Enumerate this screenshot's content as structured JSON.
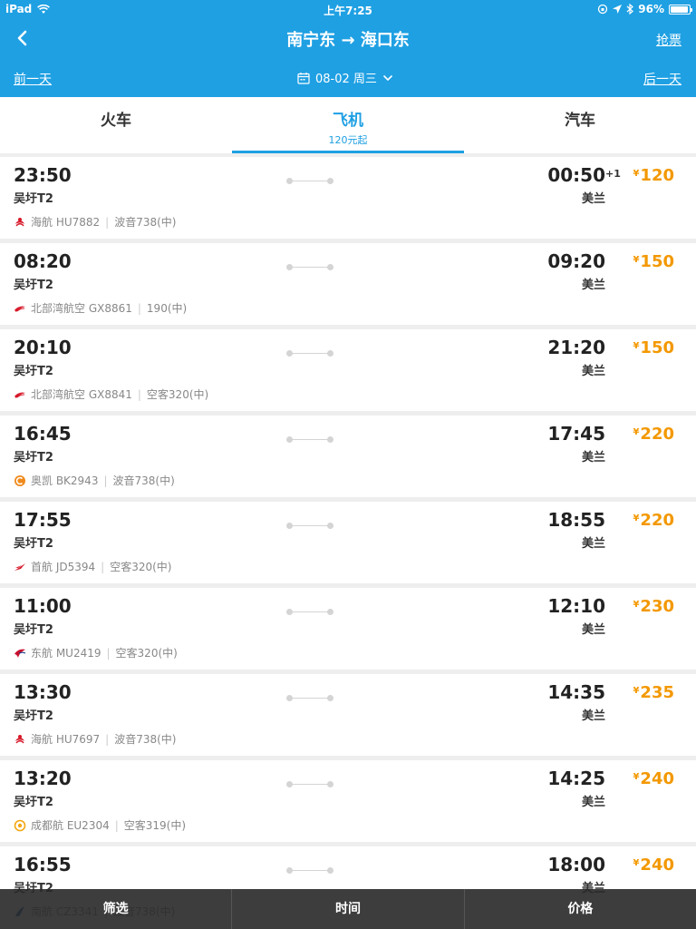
{
  "statusbar": {
    "device": "iPad",
    "time": "上午7:25",
    "battery": "96%",
    "battery_level": 0.96
  },
  "navbar": {
    "title": "南宁东 → 海口东",
    "grab_ticket": "抢票"
  },
  "datebar": {
    "prev": "前一天",
    "date": "08-02 周三",
    "next": "后一天"
  },
  "tabs": [
    {
      "label": "火车",
      "sub": ""
    },
    {
      "label": "飞机",
      "sub": "120元起"
    },
    {
      "label": "汽车",
      "sub": ""
    }
  ],
  "active_tab": 1,
  "currency_symbol": "¥",
  "flights": [
    {
      "dep": "23:50",
      "dep_airport": "吴圩T2",
      "arr": "00:50",
      "arr_plus": "+1",
      "arr_airport": "美兰",
      "price": "120",
      "airline": "海航 HU7882",
      "aircraft": "波音738(中)",
      "logo": "hainan-airlines-icon",
      "logo_color": "#d7192a"
    },
    {
      "dep": "08:20",
      "dep_airport": "吴圩T2",
      "arr": "09:20",
      "arr_plus": "",
      "arr_airport": "美兰",
      "price": "150",
      "airline": "北部湾航空 GX8861",
      "aircraft": "190(中)",
      "logo": "beibu-gulf-airlines-icon",
      "logo_color": "#d7192a"
    },
    {
      "dep": "20:10",
      "dep_airport": "吴圩T2",
      "arr": "21:20",
      "arr_plus": "",
      "arr_airport": "美兰",
      "price": "150",
      "airline": "北部湾航空 GX8841",
      "aircraft": "空客320(中)",
      "logo": "beibu-gulf-airlines-icon",
      "logo_color": "#d7192a"
    },
    {
      "dep": "16:45",
      "dep_airport": "吴圩T2",
      "arr": "17:45",
      "arr_plus": "",
      "arr_airport": "美兰",
      "price": "220",
      "airline": "奥凯 BK2943",
      "aircraft": "波音738(中)",
      "logo": "okay-airways-icon",
      "logo_color": "#f08a1c"
    },
    {
      "dep": "17:55",
      "dep_airport": "吴圩T2",
      "arr": "18:55",
      "arr_plus": "",
      "arr_airport": "美兰",
      "price": "220",
      "airline": "首航 JD5394",
      "aircraft": "空客320(中)",
      "logo": "capital-airlines-icon",
      "logo_color": "#d7192a"
    },
    {
      "dep": "11:00",
      "dep_airport": "吴圩T2",
      "arr": "12:10",
      "arr_plus": "",
      "arr_airport": "美兰",
      "price": "230",
      "airline": "东航 MU2419",
      "aircraft": "空客320(中)",
      "logo": "china-eastern-icon",
      "logo_color": "#c8102e"
    },
    {
      "dep": "13:30",
      "dep_airport": "吴圩T2",
      "arr": "14:35",
      "arr_plus": "",
      "arr_airport": "美兰",
      "price": "235",
      "airline": "海航 HU7697",
      "aircraft": "波音738(中)",
      "logo": "hainan-airlines-icon",
      "logo_color": "#d7192a"
    },
    {
      "dep": "13:20",
      "dep_airport": "吴圩T2",
      "arr": "14:25",
      "arr_plus": "",
      "arr_airport": "美兰",
      "price": "240",
      "airline": "成都航 EU2304",
      "aircraft": "空客319(中)",
      "logo": "chengdu-airlines-icon",
      "logo_color": "#f3a712"
    },
    {
      "dep": "16:55",
      "dep_airport": "吴圩T2",
      "arr": "18:00",
      "arr_plus": "",
      "arr_airport": "美兰",
      "price": "240",
      "airline": "南航 CZ3341",
      "aircraft": "波音738(中)",
      "logo": "china-southern-icon",
      "logo_color": "#1d5fa8"
    }
  ],
  "bottom_bar": {
    "filter": "筛选",
    "time": "时间",
    "price": "价格"
  },
  "colors": {
    "brand": "#1fa0e3",
    "price": "#f39800",
    "bottom_bar": "#282828"
  }
}
